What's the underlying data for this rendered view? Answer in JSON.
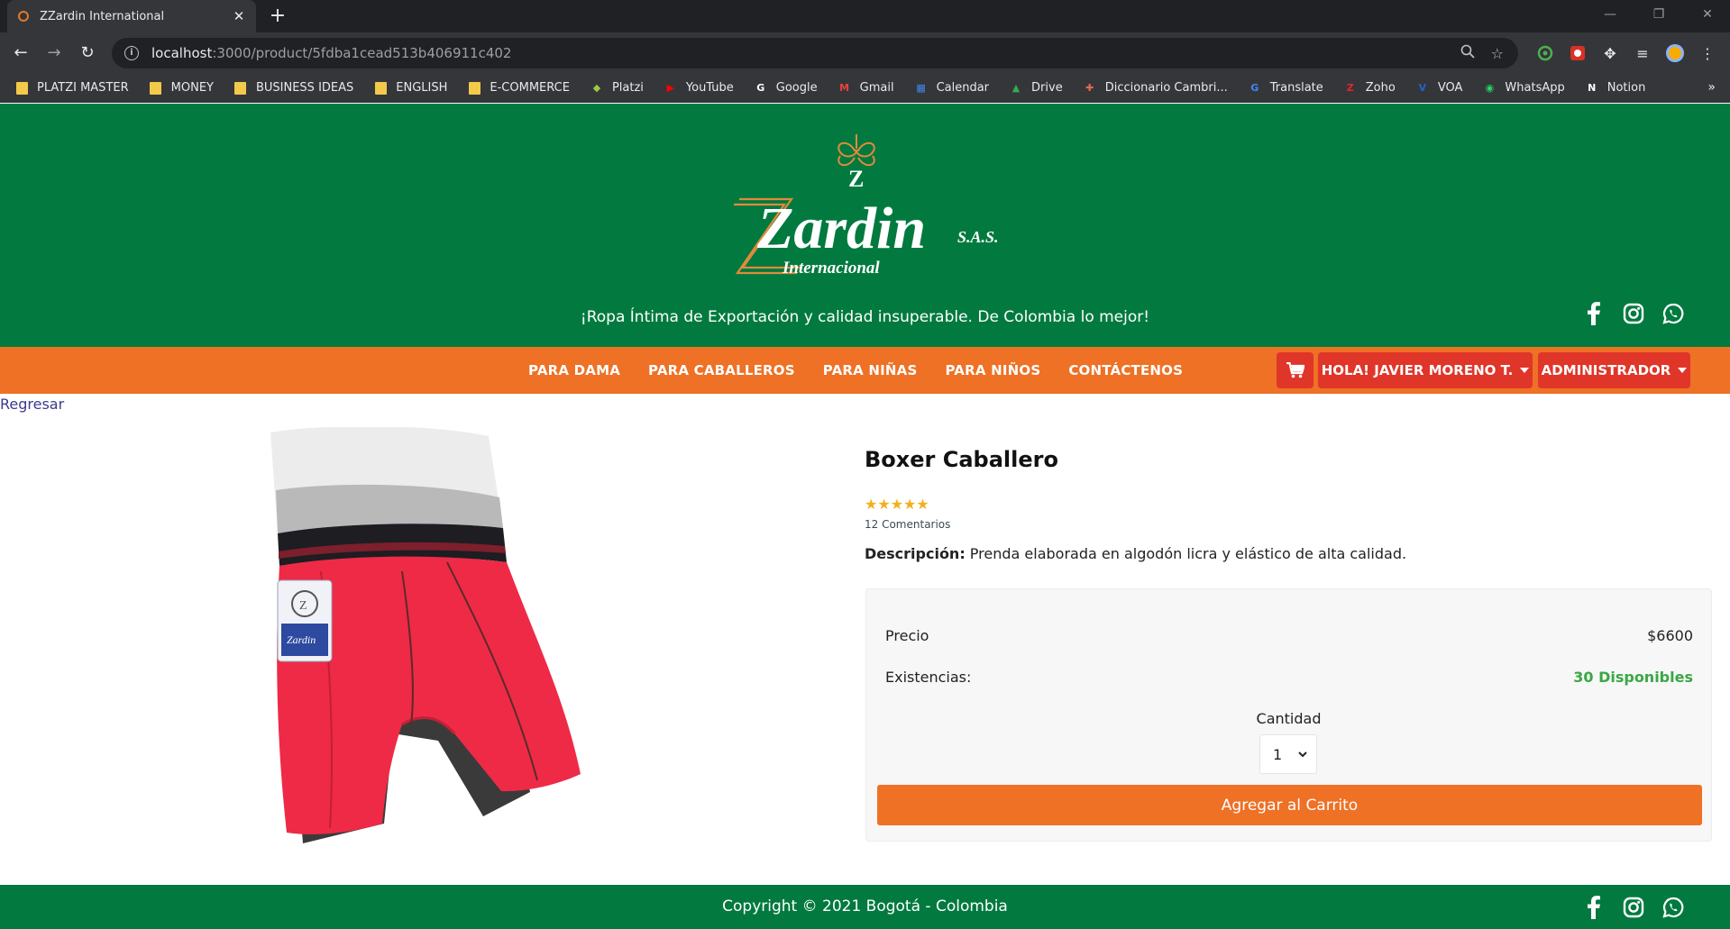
{
  "browser": {
    "tab_title": "ZZardin International",
    "url_host": "localhost",
    "url_path": ":3000/product/5fdba1cead513b406911c402",
    "bookmarks": [
      {
        "label": "PLATZI MASTER",
        "icon": "folder-icon"
      },
      {
        "label": "MONEY",
        "icon": "folder-icon"
      },
      {
        "label": "BUSINESS IDEAS",
        "icon": "folder-icon"
      },
      {
        "label": "ENGLISH",
        "icon": "folder-icon"
      },
      {
        "label": "E-COMMERCE",
        "icon": "folder-icon"
      },
      {
        "label": "Platzi",
        "icon": "platzi-icon"
      },
      {
        "label": "YouTube",
        "icon": "youtube-icon"
      },
      {
        "label": "Google",
        "icon": "google-icon"
      },
      {
        "label": "Gmail",
        "icon": "gmail-icon"
      },
      {
        "label": "Calendar",
        "icon": "calendar-icon"
      },
      {
        "label": "Drive",
        "icon": "drive-icon"
      },
      {
        "label": "Diccionario Cambri...",
        "icon": "cambridge-icon"
      },
      {
        "label": "Translate",
        "icon": "translate-icon"
      },
      {
        "label": "Zoho",
        "icon": "zoho-icon"
      },
      {
        "label": "VOA",
        "icon": "voa-icon"
      },
      {
        "label": "WhatsApp",
        "icon": "whatsapp-icon"
      },
      {
        "label": "Notion",
        "icon": "notion-icon"
      }
    ],
    "bookmarks_more": "»"
  },
  "header": {
    "logo_text": "Zardin",
    "logo_sub": "Internacional",
    "logo_sas": "S.A.S.",
    "tagline": "¡Ropa Íntima de Exportación y calidad insuperable. De Colombia lo mejor!",
    "colors": {
      "green": "#027a3f",
      "orange": "#ee7126",
      "red": "#e03529"
    }
  },
  "nav": {
    "links": [
      "PARA DAMA",
      "PARA CABALLEROS",
      "PARA NIÑAS",
      "PARA NIÑOS",
      "CONTÁCTENOS"
    ],
    "user_label": "HOLA! JAVIER MORENO T.",
    "admin_label": "ADMINISTRADOR"
  },
  "page": {
    "back_label": "Regresar"
  },
  "product": {
    "title": "Boxer Caballero",
    "rating": 5,
    "rating_max": 5,
    "reviews_label": "12 Comentarios",
    "desc_label": "Descripción:",
    "desc_text": " Prenda elaborada en algodón licra y elástico de alta calidad.",
    "price_label": "Precio",
    "price_value": "$6600",
    "stock_label": "Existencias:",
    "stock_value": "30 Disponibles",
    "qty_label": "Cantidad",
    "qty_value": "1",
    "add_to_cart": "Agregar al Carrito"
  },
  "footer": {
    "copyright": "Copyright © 2021 Bogotá - Colombia"
  }
}
